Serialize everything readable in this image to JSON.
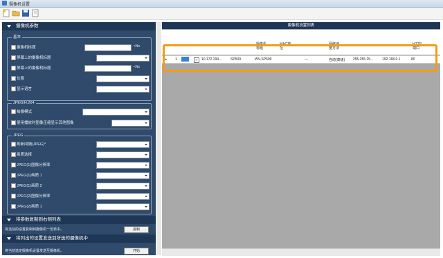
{
  "window": {
    "title": "摄像机设置"
  },
  "left_panel": {
    "section1_title": "摄像机参数",
    "basic": {
      "title": "基本",
      "rows": [
        {
          "label": "摄像机标题",
          "type": "text",
          "unit": "<Ns"
        },
        {
          "label": "屏幕上的摄像机标题",
          "type": "select"
        },
        {
          "label": "屏幕上的摄像机标题",
          "type": "text",
          "unit": "<Ns"
        },
        {
          "label": "位置",
          "type": "select"
        },
        {
          "label": "显示语言",
          "type": "select"
        }
      ]
    },
    "jpeg_h264": {
      "title": "JPEG/H.264",
      "rows": [
        {
          "label": "拍摄模式",
          "type": "select"
        },
        {
          "label": "使用播放时图像压缩显示其他图像",
          "type": "select"
        }
      ]
    },
    "jpeg": {
      "title": "JPEG",
      "rows": [
        {
          "label": "刷新间隔(JPEG)*",
          "type": "select"
        },
        {
          "label": "画质选择",
          "type": "select"
        },
        {
          "label": "JPEG(1)图像分辨率",
          "type": "select"
        },
        {
          "label": "JPEG(1)画质 1",
          "type": "select"
        },
        {
          "label": "JPEG(1)画质 2",
          "type": "select"
        },
        {
          "label": "JPEG(2)图像分辨率",
          "type": "select"
        },
        {
          "label": "JPEG(2)画质 1",
          "type": "select"
        }
      ]
    },
    "section2_title": "将参数复制到右侧列表",
    "copy_text": "将当前的设置复制到摄像机一览表中。",
    "copy_button": "复制",
    "section3_title": "将列出的设置发送到所选的摄像机中",
    "send_text": "将当前选定摄像机设置发送至摄像机。",
    "send_button": "开始"
  },
  "right_panel": {
    "title": "摄像机设置列表",
    "columns": [
      "",
      "",
      "",
      "",
      "摄像机\n标题",
      "MAC地\n址",
      "",
      "网络速\n度方法",
      "",
      "",
      "HTTP\n端口"
    ],
    "rows": [
      {
        "index": "1",
        "checked": "✓",
        "ip": "10.172.194...",
        "model": "SP509",
        "title": "WV-SP509",
        "mac": "",
        "dash": "—",
        "net": "自动(高级)",
        "mask": "255.255.25...",
        "gw": "192.168.0.1",
        "port": "80"
      }
    ]
  },
  "colors": {
    "accent": "#f39c12",
    "panel": "#2f4a6b",
    "header": "#1f3756"
  }
}
